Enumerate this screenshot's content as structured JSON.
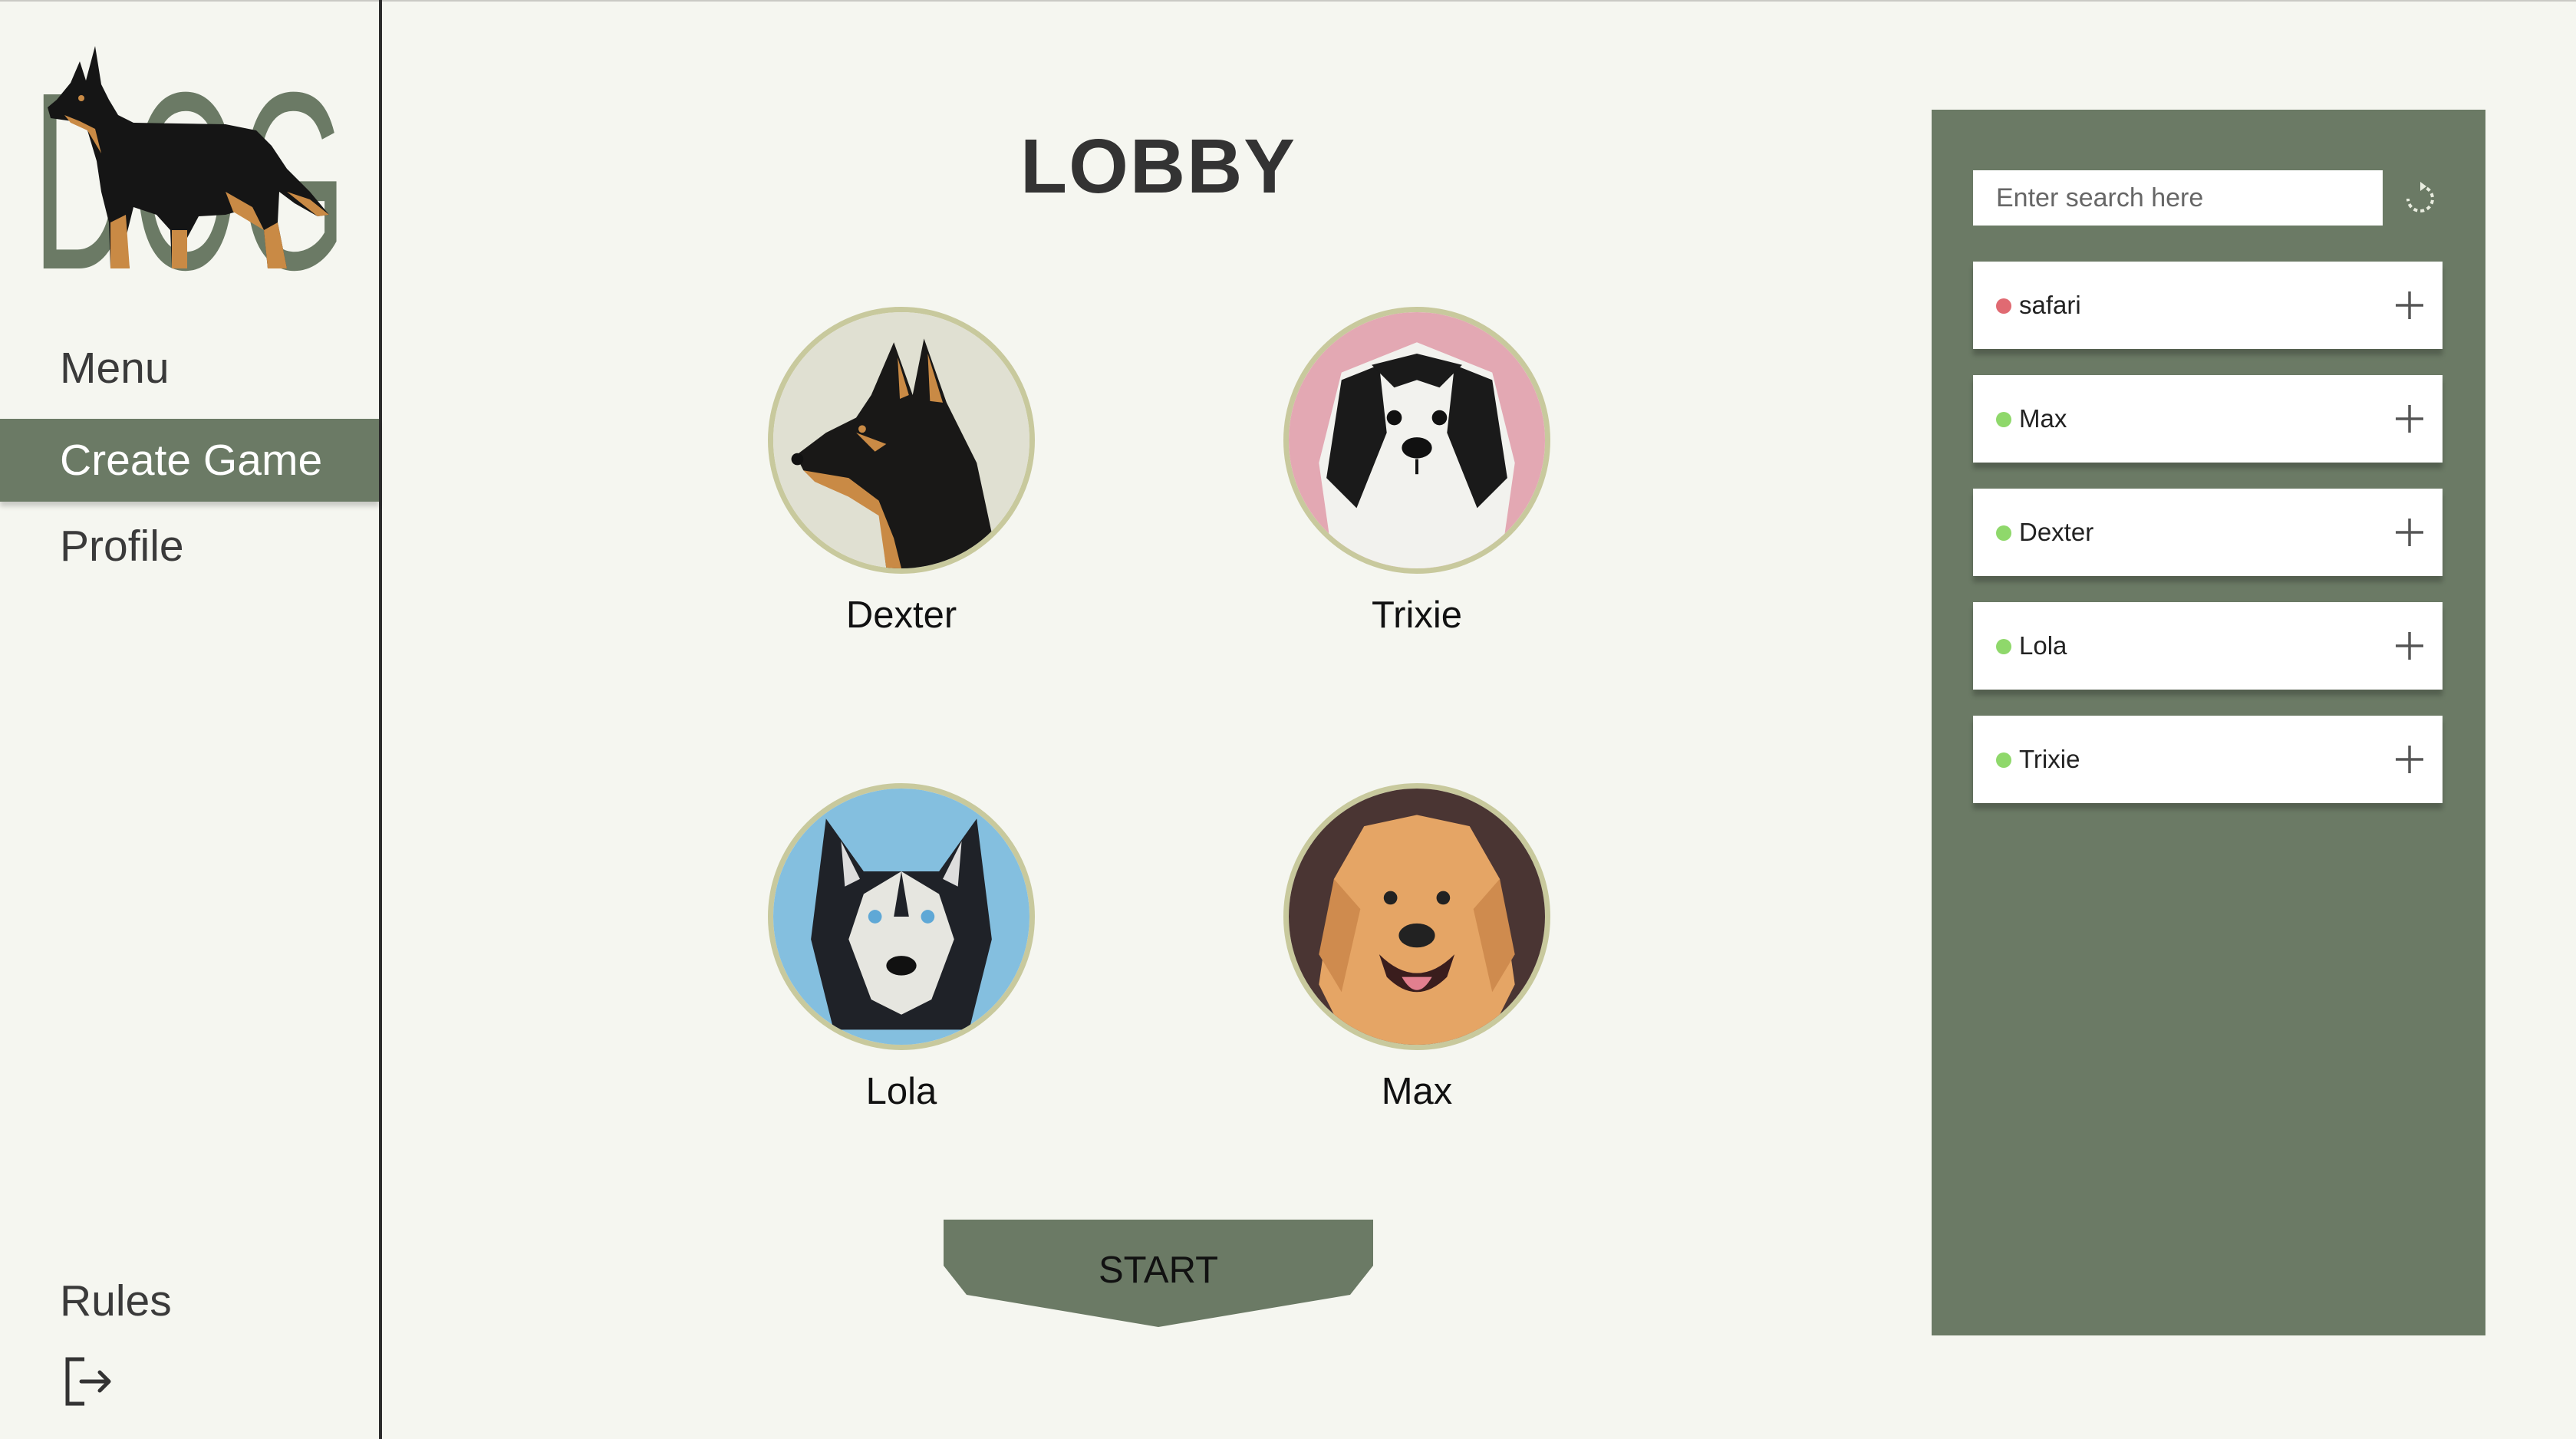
{
  "logo": {
    "text": "DOG"
  },
  "nav": {
    "menu": "Menu",
    "create_game": "Create Game",
    "profile": "Profile",
    "rules": "Rules"
  },
  "lobby": {
    "title": "LOBBY",
    "players": [
      {
        "name": "Dexter"
      },
      {
        "name": "Trixie"
      },
      {
        "name": "Lola"
      },
      {
        "name": "Max"
      }
    ],
    "start_label": "START"
  },
  "panel": {
    "search_placeholder": "Enter search here",
    "users": [
      {
        "name": "safari",
        "status": "offline",
        "status_color": "#e06a72"
      },
      {
        "name": "Max",
        "status": "online",
        "status_color": "#8fd86b"
      },
      {
        "name": "Dexter",
        "status": "online",
        "status_color": "#8fd86b"
      },
      {
        "name": "Lola",
        "status": "online",
        "status_color": "#8fd86b"
      },
      {
        "name": "Trixie",
        "status": "online",
        "status_color": "#8fd86b"
      }
    ]
  },
  "colors": {
    "accent": "#6b7a65",
    "background": "#f5f6f0",
    "avatar_border": "#c8c99d"
  }
}
